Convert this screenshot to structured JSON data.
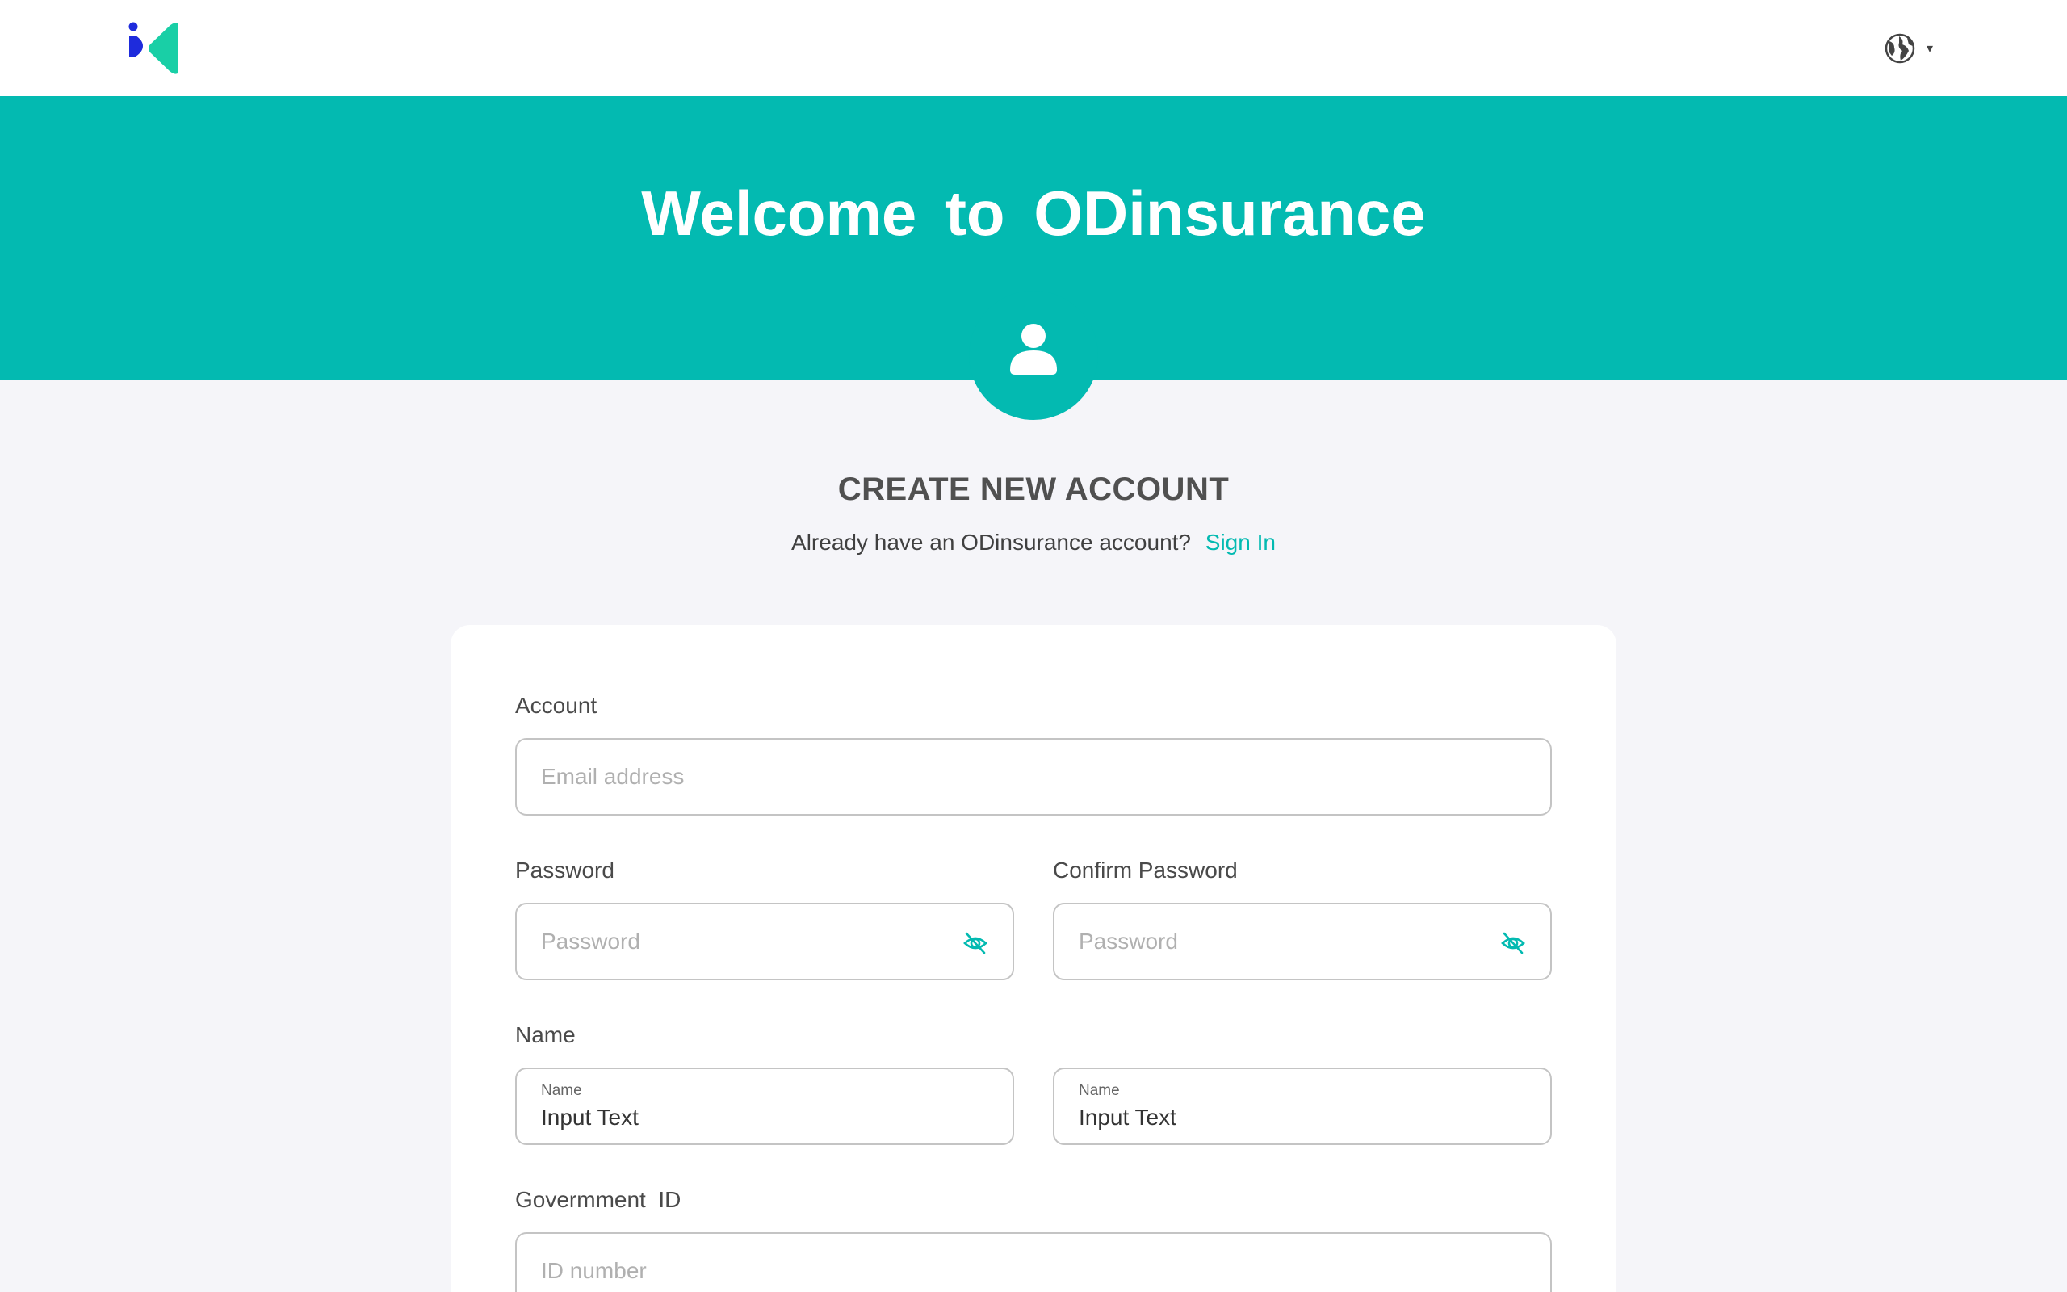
{
  "brand": {
    "accent": "#03bab1",
    "logo_dot_color": "#1e2bdc",
    "logo_arrow_color": "#19cfa6"
  },
  "topbar": {
    "language_icon": "globe-icon",
    "language_caret": "▾"
  },
  "hero": {
    "title": "Welcome to ODinsurance",
    "avatar_icon": "user-icon"
  },
  "intro": {
    "heading": "CREATE NEW ACCOUNT",
    "prompt": "Already have an ODinsurance account?",
    "signin_link": "Sign In"
  },
  "form": {
    "account": {
      "label": "Account",
      "placeholder": "Email address"
    },
    "password": {
      "label": "Password",
      "placeholder": "Password",
      "toggle_icon": "eye-off-icon"
    },
    "confirm_password": {
      "label": "Confirm Password",
      "placeholder": "Password",
      "toggle_icon": "eye-off-icon"
    },
    "name": {
      "label": "Name",
      "first": {
        "mini_label": "Name",
        "value": "Input Text"
      },
      "last": {
        "mini_label": "Name",
        "value": "Input Text"
      }
    },
    "government_id": {
      "label": "Govermment  ID",
      "placeholder": "ID number"
    }
  }
}
